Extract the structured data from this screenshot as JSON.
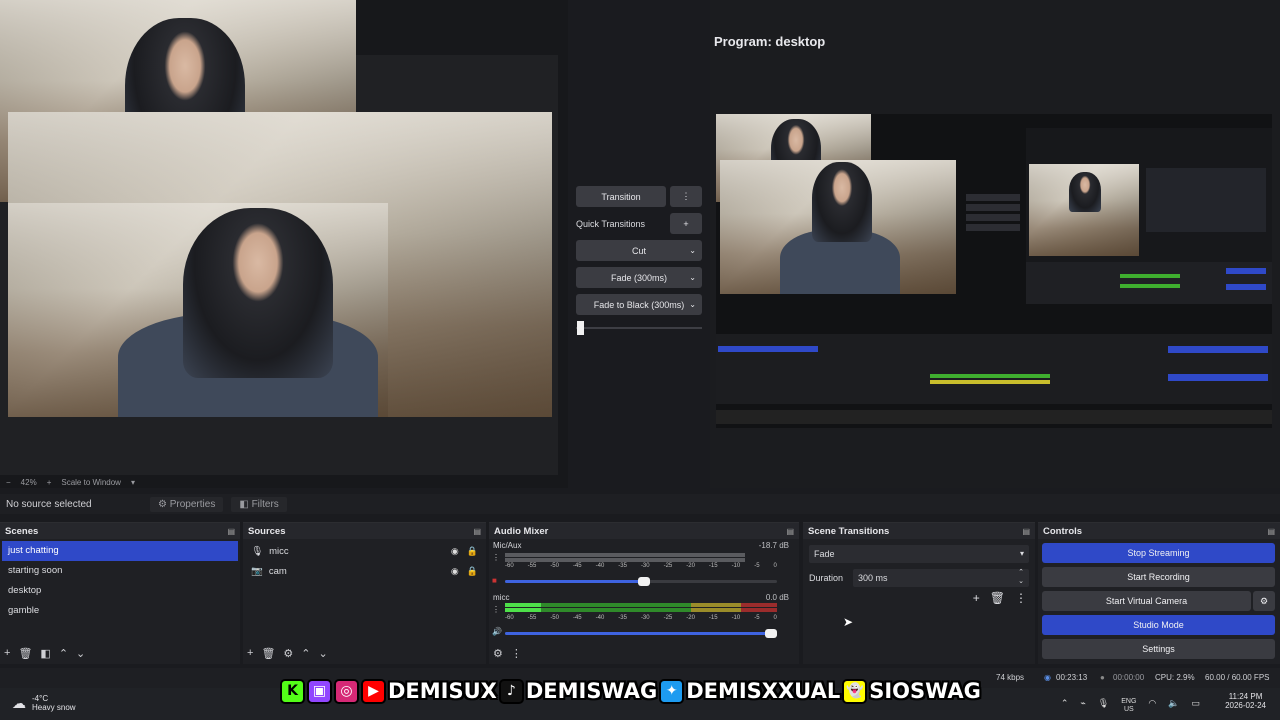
{
  "window": {
    "controls": [
      "–",
      "❐",
      "✕"
    ]
  },
  "preview": {
    "zoom_percent": "42%",
    "scale_mode": "Scale to Window"
  },
  "transition_panel": {
    "transition_label": "Transition",
    "quick_transitions_label": "Quick Transitions",
    "quick_items": [
      "Cut",
      "Fade (300ms)",
      "Fade to Black (300ms)"
    ],
    "tbar_value": 0
  },
  "program": {
    "title": "Program: desktop"
  },
  "props_bar": {
    "no_source": "No source selected",
    "properties": "Properties",
    "filters": "Filters"
  },
  "scenes": {
    "title": "Scenes",
    "items": [
      "just chatting",
      "starting soon",
      "desktop",
      "gamble"
    ],
    "active": 0
  },
  "sources": {
    "title": "Sources",
    "items": [
      {
        "name": "micc",
        "icon": "mic-icon"
      },
      {
        "name": "cam",
        "icon": "camera-icon"
      }
    ]
  },
  "audio_mixer": {
    "title": "Audio Mixer",
    "channels": [
      {
        "name": "Mic/Aux",
        "db": "-18.7 dB",
        "volume": 0.51
      },
      {
        "name": "micc",
        "db": "0.0 dB",
        "volume": 1.0
      }
    ],
    "ticks": [
      "-60",
      "-55",
      "-50",
      "-45",
      "-40",
      "-35",
      "-30",
      "-25",
      "-20",
      "-15",
      "-10",
      "-5",
      "0"
    ]
  },
  "scene_transitions": {
    "title": "Scene Transitions",
    "selected": "Fade",
    "duration_label": "Duration",
    "duration_value": "300 ms"
  },
  "controls": {
    "title": "Controls",
    "stop_streaming": "Stop Streaming",
    "start_recording": "Start Recording",
    "start_virtual_camera": "Start Virtual Camera",
    "studio_mode": "Studio Mode",
    "settings": "Settings"
  },
  "status": {
    "kbps": "74 kbps",
    "stream_time": "00:23:13",
    "rec_time": "00:00:00",
    "cpu": "CPU: 2.9%",
    "fps": "60.00 / 60.00 FPS"
  },
  "overlay": {
    "handles": [
      "DEMISUX",
      "DEMISWAG",
      "DEMISXXUAL",
      "SIOSWAG"
    ]
  },
  "taskbar": {
    "temperature": "-4°C",
    "weather": "Heavy snow",
    "lang": "ENG",
    "region": "US",
    "time": "11:24 PM",
    "date": "2026-02-24"
  },
  "colors": {
    "accent": "#2f49c8",
    "panel": "#1f2024",
    "button": "#3a3b41"
  }
}
